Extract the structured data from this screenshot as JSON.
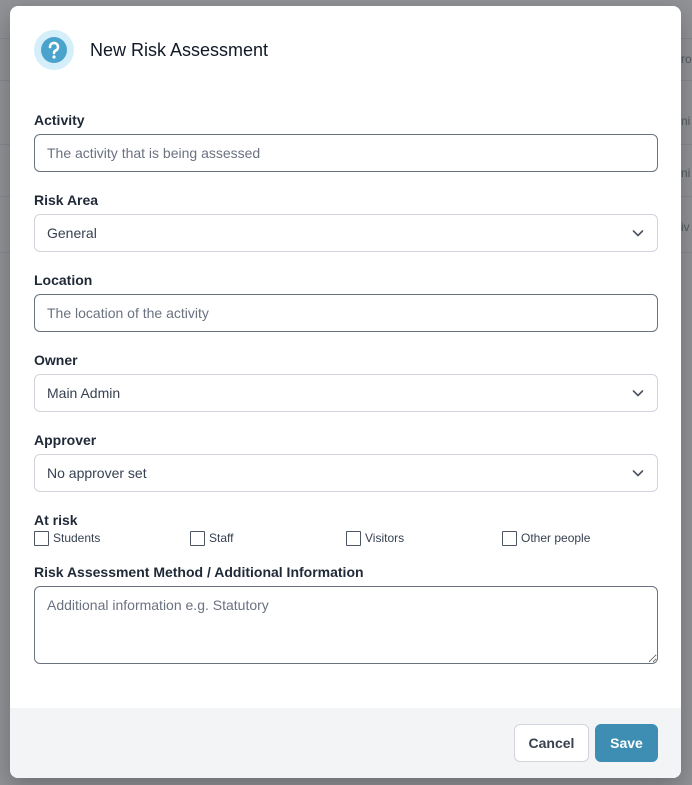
{
  "background": {
    "fragments": [
      "ro",
      "ni",
      "ni",
      "iv"
    ]
  },
  "modal": {
    "title": "New Risk Assessment",
    "icon": "question-circle-icon",
    "accent": "#3e8eb4"
  },
  "form": {
    "activity": {
      "label": "Activity",
      "placeholder": "The activity that is being assessed",
      "value": ""
    },
    "risk_area": {
      "label": "Risk Area",
      "value": "General"
    },
    "location": {
      "label": "Location",
      "placeholder": "The location of the activity",
      "value": ""
    },
    "owner": {
      "label": "Owner",
      "value": "Main Admin"
    },
    "approver": {
      "label": "Approver",
      "value": "No approver set"
    },
    "at_risk": {
      "label": "At risk",
      "options": [
        {
          "label": "Students",
          "checked": false
        },
        {
          "label": "Staff",
          "checked": false
        },
        {
          "label": "Visitors",
          "checked": false
        },
        {
          "label": "Other people",
          "checked": false
        }
      ]
    },
    "method": {
      "label": "Risk Assessment Method / Additional Information",
      "placeholder": "Additional information e.g. Statutory",
      "value": ""
    }
  },
  "footer": {
    "cancel_label": "Cancel",
    "save_label": "Save"
  }
}
